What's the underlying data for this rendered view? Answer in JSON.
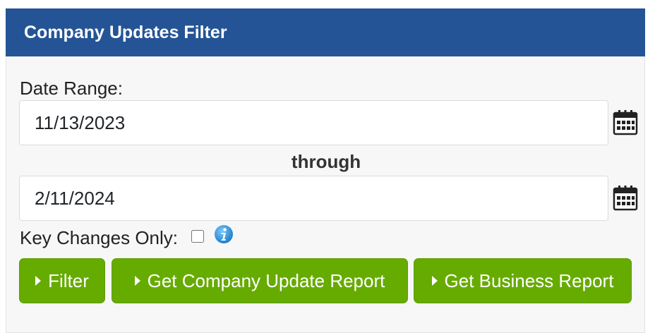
{
  "header": {
    "title": "Company Updates Filter"
  },
  "filter": {
    "date_range_label": "Date Range:",
    "start_date": "11/13/2023",
    "through_label": "through",
    "end_date": "2/11/2024",
    "key_changes_label": "Key Changes Only:",
    "key_changes_checked": false
  },
  "buttons": {
    "filter_label": "Filter",
    "company_update_report_label": "Get Company Update Report",
    "business_report_label": "Get Business Report"
  },
  "colors": {
    "header_bg": "#245496",
    "button_bg": "#66ab00",
    "panel_bg": "#f7f7f7"
  },
  "icons": {
    "calendar": "calendar-icon",
    "info": "info-icon",
    "caret": "caret-right-icon"
  }
}
